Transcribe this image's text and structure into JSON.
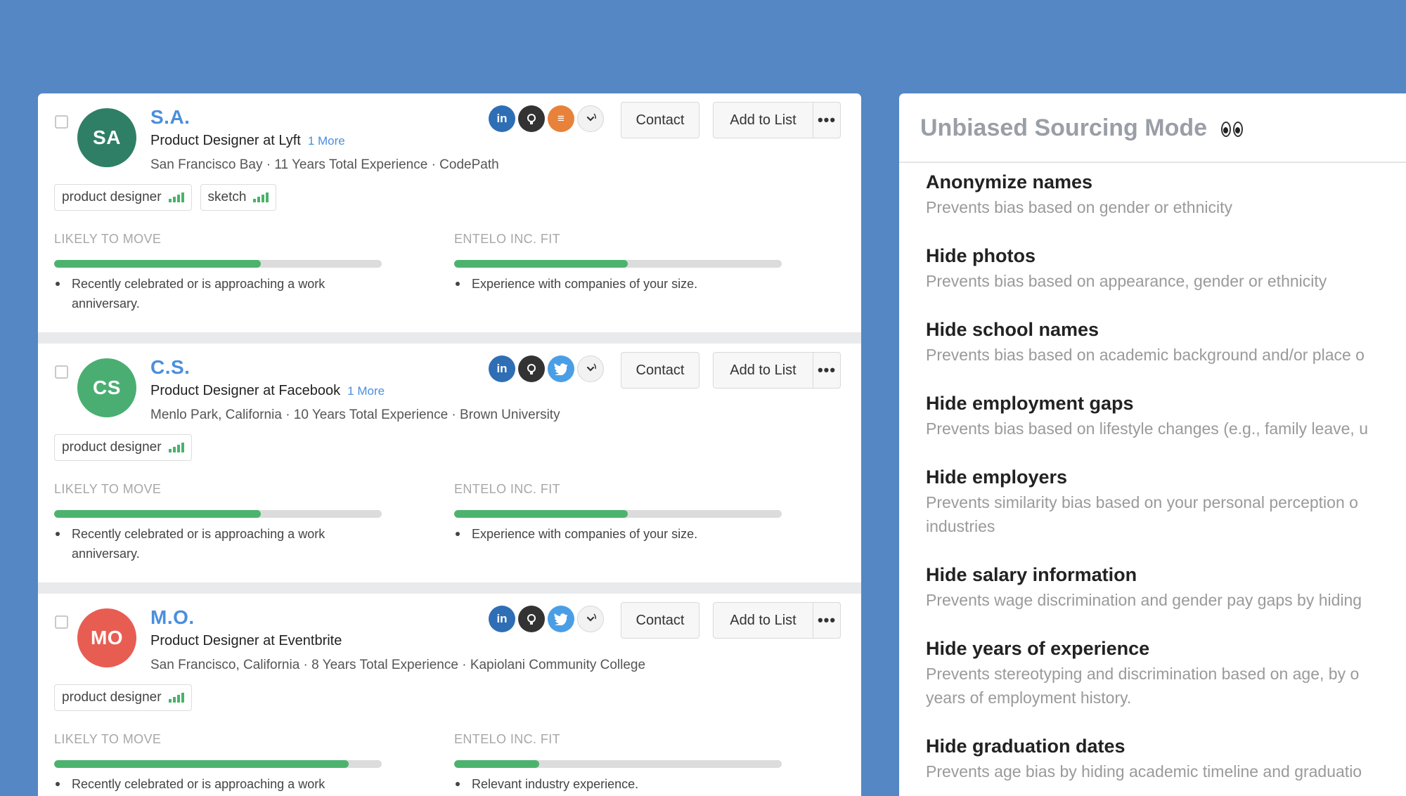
{
  "candidates": [
    {
      "initials": "SA",
      "avatar_color": "#2f7f66",
      "name": "S.A.",
      "headline": "Product Designer at Lyft",
      "more": "1 More",
      "subline": "San Francisco Bay · 11 Years Total Experience · CodePath",
      "social": [
        "linkedin-icon",
        "github-icon",
        "stackoverflow-icon",
        "expand-icon"
      ],
      "tags": [
        {
          "label": "product designer"
        },
        {
          "label": "sketch"
        }
      ],
      "likely_label": "LIKELY TO MOVE",
      "likely_fill": 0.63,
      "likely_bullet": "Recently celebrated or is approaching a work anniversary.",
      "fit_label": "ENTELO INC. FIT",
      "fit_fill": 0.53,
      "fit_bullet": "Experience with companies of your size."
    },
    {
      "initials": "CS",
      "avatar_color": "#4aae72",
      "name": "C.S.",
      "headline": "Product Designer at Facebook",
      "more": "1 More",
      "subline": "Menlo Park, California · 10 Years Total Experience · Brown University",
      "social": [
        "linkedin-icon",
        "github-icon",
        "twitter-icon",
        "expand-icon"
      ],
      "tags": [
        {
          "label": "product designer"
        }
      ],
      "likely_label": "LIKELY TO MOVE",
      "likely_fill": 0.63,
      "likely_bullet": "Recently celebrated or is approaching a work anniversary.",
      "fit_label": "ENTELO INC. FIT",
      "fit_fill": 0.53,
      "fit_bullet": "Experience with companies of your size."
    },
    {
      "initials": "MO",
      "avatar_color": "#e85d52",
      "name": "M.O.",
      "headline": "Product Designer at Eventbrite",
      "more": "",
      "subline": "San Francisco, California · 8 Years Total Experience · Kapiolani Community College",
      "social": [
        "linkedin-icon",
        "github-icon",
        "twitter-icon",
        "expand-icon"
      ],
      "tags": [
        {
          "label": "product designer"
        }
      ],
      "likely_label": "LIKELY TO MOVE",
      "likely_fill": 0.9,
      "likely_bullet": "Recently celebrated or is approaching a work",
      "fit_label": "ENTELO INC. FIT",
      "fit_fill": 0.26,
      "fit_bullet": "Relevant industry experience."
    }
  ],
  "buttons": {
    "contact": "Contact",
    "add_to_list": "Add to List",
    "more": "•••"
  },
  "unbiased": {
    "title": "Unbiased Sourcing Mode",
    "options": [
      {
        "title": "Anonymize names",
        "desc": "Prevents bias based on gender or ethnicity"
      },
      {
        "title": "Hide photos",
        "desc": "Prevents bias based on appearance, gender or ethnicity"
      },
      {
        "title": "Hide school names",
        "desc": "Prevents bias based on academic background and/or place o"
      },
      {
        "title": "Hide employment gaps",
        "desc": "Prevents bias based on lifestyle changes (e.g., family leave, u"
      },
      {
        "title": "Hide employers",
        "desc": "Prevents similarity bias based on your personal perception o",
        "desc2": "industries"
      },
      {
        "title": "Hide salary information",
        "desc": "Prevents wage discrimination and gender pay gaps by hiding"
      },
      {
        "title": "Hide years of experience",
        "desc": "Prevents stereotyping and discrimination based on age, by o",
        "desc2": "years of employment history."
      },
      {
        "title": "Hide graduation dates",
        "desc": "Prevents age bias by hiding academic timeline and graduatio"
      }
    ]
  },
  "colors": {
    "background": "#5587c4",
    "link": "#4a8fdd",
    "bar_fill": "#4cb36e"
  }
}
